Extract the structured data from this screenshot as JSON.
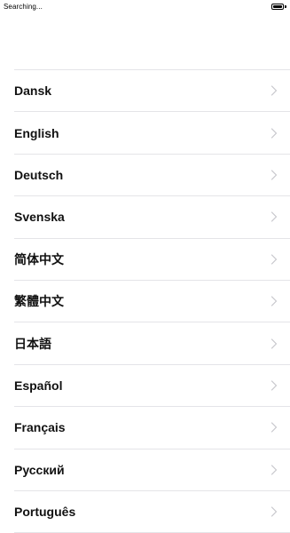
{
  "status_bar": {
    "text": "Searching...",
    "battery_icon": "battery-full-icon"
  },
  "languages": [
    {
      "label": "Dansk"
    },
    {
      "label": "English"
    },
    {
      "label": "Deutsch"
    },
    {
      "label": "Svenska"
    },
    {
      "label": "简体中文"
    },
    {
      "label": "繁體中文"
    },
    {
      "label": "日本語"
    },
    {
      "label": "Español"
    },
    {
      "label": "Français"
    },
    {
      "label": "Русский"
    },
    {
      "label": "Português"
    }
  ],
  "icons": {
    "row_chevron": "chevron-right-icon"
  },
  "colors": {
    "separator": "#e4e4e8",
    "chevron": "#c7c7cc",
    "text": "#111111"
  }
}
